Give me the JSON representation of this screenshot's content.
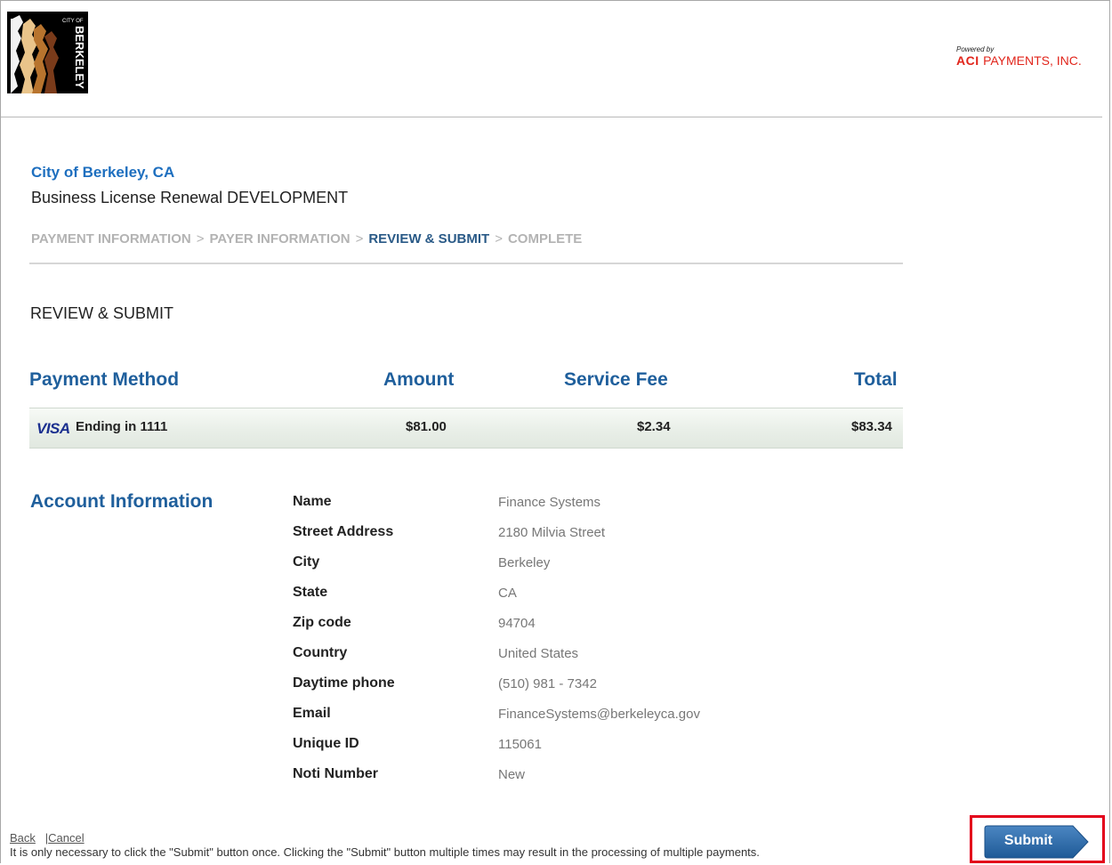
{
  "header": {
    "logo": {
      "label": "City of Berkeley logo",
      "text_small": "CITY OF",
      "text_large": "BERKELEY"
    },
    "aci": {
      "powered_by": "Powered by",
      "brand": "ACI",
      "company": "PAYMENTS, INC."
    }
  },
  "org_name": "City of Berkeley, CA",
  "app_name": "Business License Renewal DEVELOPMENT",
  "steps": [
    {
      "label": "PAYMENT INFORMATION",
      "active": false
    },
    {
      "label": "PAYER INFORMATION",
      "active": false
    },
    {
      "label": "REVIEW & SUBMIT",
      "active": true
    },
    {
      "label": "COMPLETE",
      "active": false
    }
  ],
  "step_separator": ">",
  "section_title": "REVIEW & SUBMIT",
  "payment_table": {
    "headers": {
      "method": "Payment Method",
      "amount": "Amount",
      "fee": "Service Fee",
      "total": "Total"
    },
    "row": {
      "card_brand": "VISA",
      "card_text": "Ending in 1111",
      "amount": "$81.00",
      "fee": "$2.34",
      "total": "$83.34"
    }
  },
  "account": {
    "title": "Account Information",
    "fields": [
      {
        "label": "Name",
        "value": "Finance Systems"
      },
      {
        "label": "Street Address",
        "value": "2180 Milvia Street"
      },
      {
        "label": "City",
        "value": "Berkeley"
      },
      {
        "label": "State",
        "value": "CA"
      },
      {
        "label": "Zip code",
        "value": "94704"
      },
      {
        "label": "Country",
        "value": "United States"
      },
      {
        "label": "Daytime phone",
        "value": "(510) 981 - 7342"
      },
      {
        "label": "Email",
        "value": "FinanceSystems@berkeleyca.gov"
      },
      {
        "label": "Unique ID",
        "value": "115061"
      },
      {
        "label": "Noti Number",
        "value": "New"
      }
    ]
  },
  "footer": {
    "back_label": "Back",
    "link_separator": "|",
    "cancel_label": "Cancel",
    "note": "It is only necessary to click the \"Submit\" button once. Clicking the \"Submit\" button multiple times may result in the processing of multiple payments."
  },
  "submit_label": "Submit",
  "colors": {
    "heading_blue": "#1f5f9c",
    "org_blue": "#1e6fbf",
    "submit_blue": "#2f6aa6",
    "highlight_red": "#e3001b",
    "aci_red": "#e1251b"
  }
}
